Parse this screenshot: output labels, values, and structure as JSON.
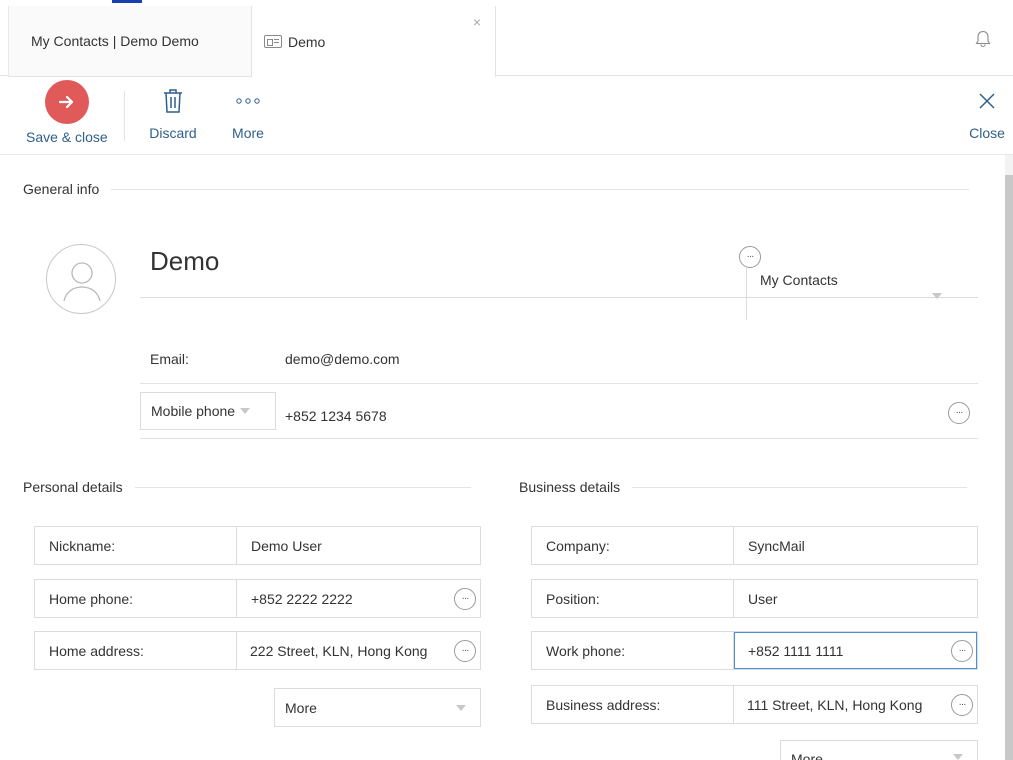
{
  "tabs": [
    {
      "label": "My Contacts | Demo Demo"
    },
    {
      "label": "Demo"
    }
  ],
  "toolbar": {
    "save_label": "Save & close",
    "discard_label": "Discard",
    "more_label": "More",
    "close_label": "Close"
  },
  "general": {
    "section_title": "General info",
    "name": "Demo",
    "group": "My Contacts",
    "email_label": "Email:",
    "email_value": "demo@demo.com",
    "phone_type": "Mobile phone",
    "phone_value": "+852 1234 5678"
  },
  "personal": {
    "section_title": "Personal details",
    "fields": [
      {
        "label": "Nickname:",
        "value": "Demo User"
      },
      {
        "label": "Home phone:",
        "value": "+852 2222 2222"
      },
      {
        "label": "Home address:",
        "value": "222 Street, KLN, Hong Kong"
      }
    ],
    "more_label": "More"
  },
  "business": {
    "section_title": "Business details",
    "fields": [
      {
        "label": "Company:",
        "value": "SyncMail"
      },
      {
        "label": "Position:",
        "value": "User"
      },
      {
        "label": "Work phone:",
        "value": "+852 1111 1111"
      },
      {
        "label": "Business address:",
        "value": "111 Street, KLN, Hong Kong"
      }
    ],
    "more_label": "More"
  },
  "colors": {
    "accent": "#e05a5a",
    "link": "#2e5f8a",
    "focus": "#4a90d9"
  },
  "icons": [
    "contact-card-icon",
    "tab-close-icon",
    "bell-icon",
    "arrow-right-icon",
    "trash-icon",
    "more-dots-icon",
    "close-icon",
    "avatar-icon",
    "ellipsis-icon",
    "caret-down-icon"
  ]
}
